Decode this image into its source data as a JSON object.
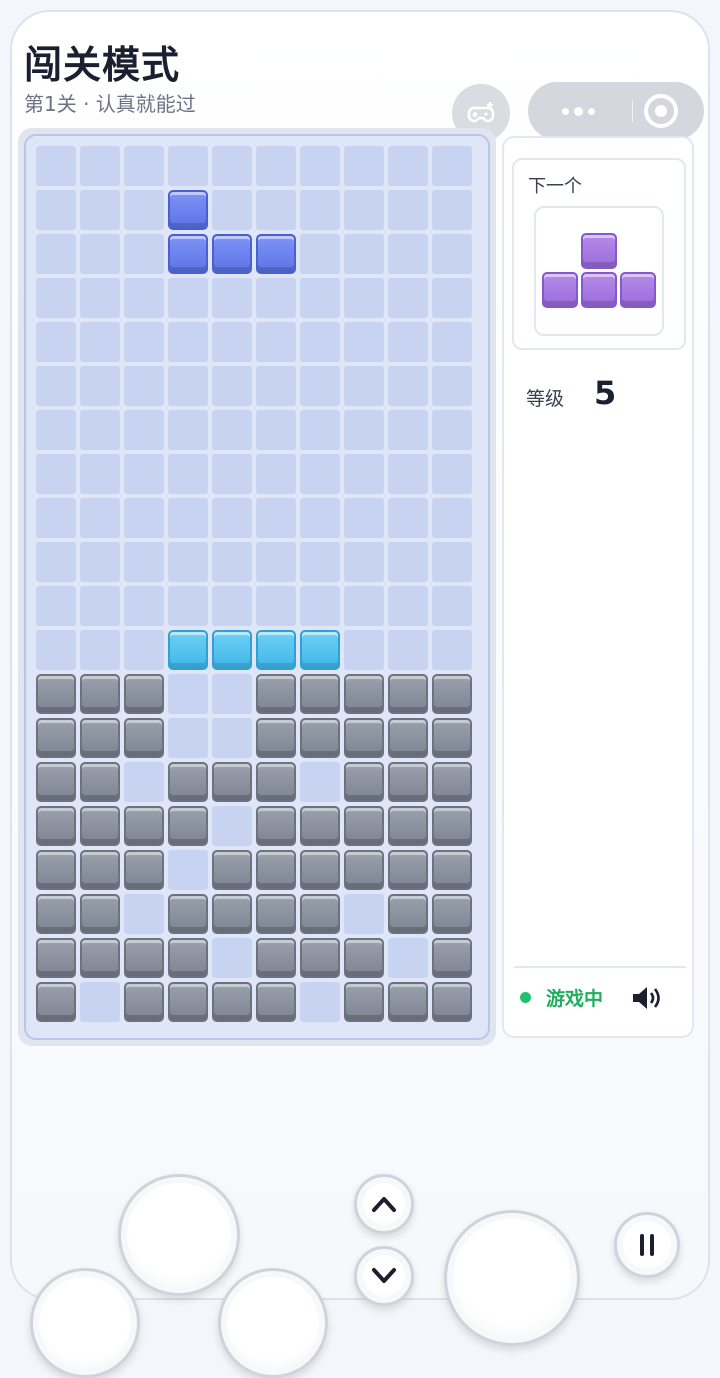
{
  "header": {
    "title": "闯关模式",
    "subtitle": "第1关 · 认真就能过"
  },
  "board": {
    "cols": 10,
    "rows": 20,
    "empty_color": "#c7d3f1",
    "active_piece": {
      "color": "blue",
      "cells": [
        [
          3,
          1
        ],
        [
          3,
          2
        ],
        [
          4,
          2
        ],
        [
          5,
          2
        ]
      ]
    },
    "ghost_piece": {
      "color": "cyan",
      "cells": [
        [
          3,
          11
        ],
        [
          4,
          11
        ],
        [
          5,
          11
        ],
        [
          6,
          11
        ]
      ]
    },
    "locked_rows": [
      "GGG..GGGGG",
      "GGG..GGGGG",
      "GG.GGG.GGG",
      "GGGG.GGGGG",
      "GGG.GGGGGG",
      "GG.GGGG.GG",
      "GGGG.GGG.G",
      "G.GGGG.GGG"
    ]
  },
  "side": {
    "next_label": "下一个",
    "next_piece": {
      "type": "T",
      "color": "purple"
    },
    "level_label": "等级",
    "level_value": "5",
    "status_text": "游戏中",
    "status_color": "#1fae5e"
  },
  "icons": {
    "gamepad": "gamepad-icon",
    "more": "more-dots-icon",
    "close": "target-icon",
    "sound": "speaker-icon",
    "rotate_up": "chevron-up-icon",
    "drop_down": "chevron-down-icon",
    "pause": "pause-icon"
  }
}
